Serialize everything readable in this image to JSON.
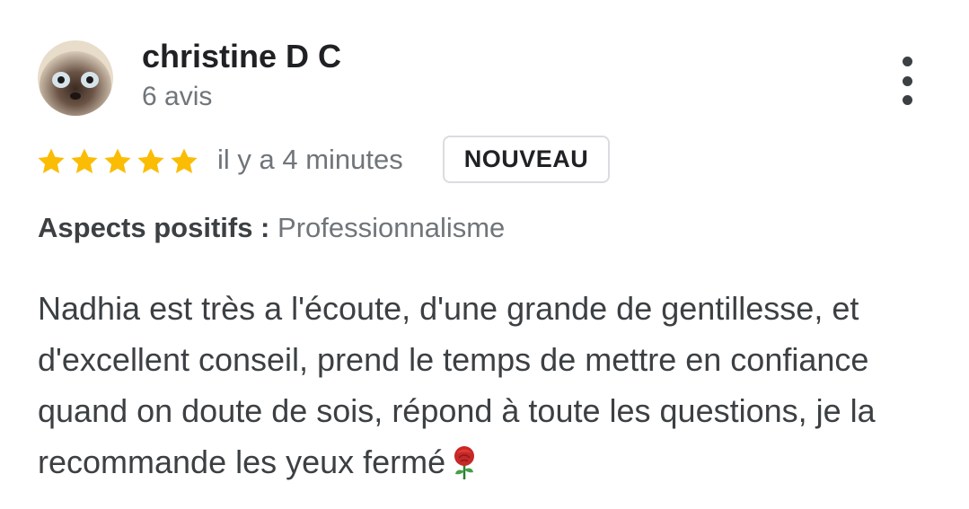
{
  "author": {
    "name": "christine D C",
    "review_count": "6 avis",
    "avatar_icon": "siamese-cat-avatar"
  },
  "rating": {
    "stars": 5,
    "max": 5,
    "star_color": "#fbbc04"
  },
  "time_ago": "il y a 4 minutes",
  "badge": "NOUVEAU",
  "aspects": {
    "label": "Aspects positifs :",
    "value": "Professionnalisme"
  },
  "review": {
    "text": "Nadhia est très a l'écoute, d'une grande de gentillesse, et d'excellent conseil, prend le temps de mettre en confiance quand on doute de sois, répond à toute les questions, je la recommande les yeux fermé",
    "emoji_icon": "rose-icon"
  },
  "menu": {
    "icon": "more-vert-icon"
  }
}
